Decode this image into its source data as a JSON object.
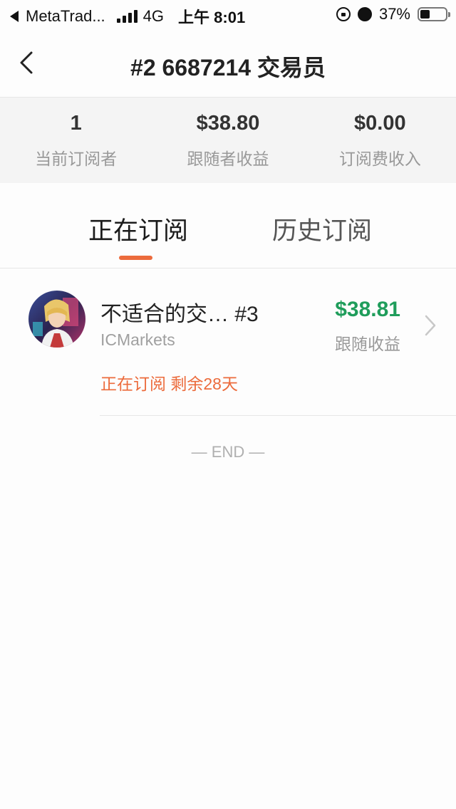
{
  "status_bar": {
    "back_app": "MetaTrad...",
    "network": "4G",
    "time": "上午 8:01",
    "battery_text": "37%",
    "battery_level": 0.37,
    "signal_bars": 4
  },
  "nav": {
    "title": "#2 6687214 交易员",
    "back_icon": "chevron-left-icon"
  },
  "stats": [
    {
      "value": "1",
      "label": "当前订阅者"
    },
    {
      "value": "$38.80",
      "label": "跟随者收益"
    },
    {
      "value": "$0.00",
      "label": "订阅费收入"
    }
  ],
  "tabs": {
    "active": "正在订阅",
    "inactive": "历史订阅"
  },
  "subscription": {
    "name": "不适合的交… #3",
    "broker": "ICMarkets",
    "status": "正在订阅 剩余28天",
    "profit": "$38.81",
    "profit_label": "跟随收益"
  },
  "end_text": "— END —",
  "colors": {
    "accent": "#ec6b3c",
    "profit_green": "#1f9d5b",
    "stats_bg": "#f4f4f4"
  }
}
